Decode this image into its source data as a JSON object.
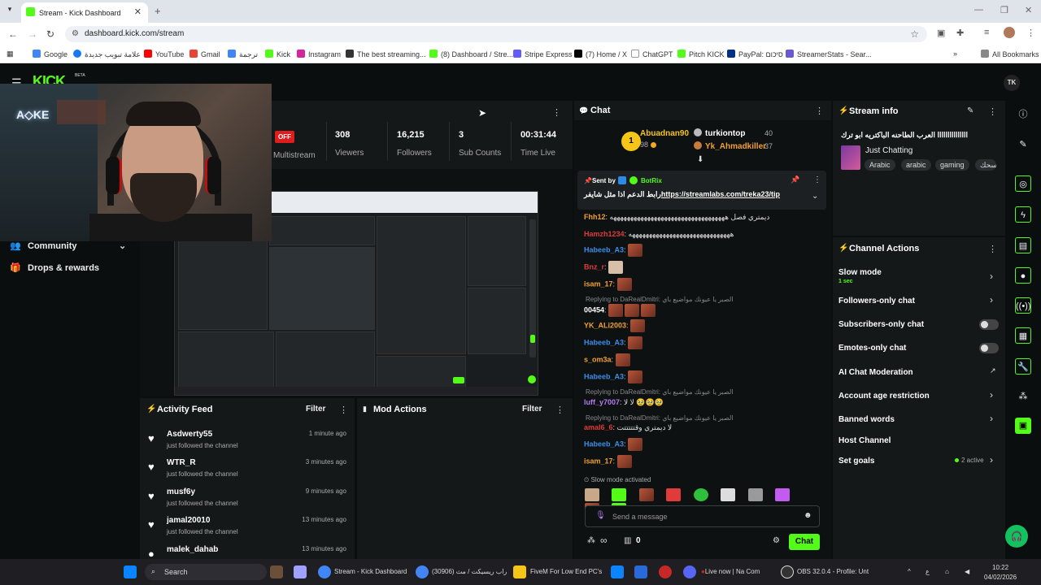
{
  "browser": {
    "tab_title": "Stream - Kick Dashboard",
    "url": "dashboard.kick.com/stream",
    "bookmarks": [
      "Google",
      "علامة تبويب جديدة",
      "YouTube",
      "Gmail",
      "ترجمة",
      "Kick",
      "Instagram",
      "The best streaming...",
      "(8) Dashboard / Stre...",
      "Stripe Express",
      "(7) Home / X",
      "ChatGPT",
      "Pitch KICK",
      "PayPal: סיכום",
      "StreamerStats - Sear..."
    ],
    "all_bookmarks": "All Bookmarks"
  },
  "kick": {
    "logo": "KICK",
    "beta": "BETA",
    "avatar_initials": "TK"
  },
  "sidebar": {
    "items": [
      {
        "label": "Community"
      },
      {
        "label": "Drops & rewards"
      }
    ]
  },
  "stats": {
    "status": "OFF",
    "multistream": "Multistream",
    "items": [
      {
        "value": "308",
        "label": "Viewers"
      },
      {
        "value": "16,215",
        "label": "Followers"
      },
      {
        "value": "3",
        "label": "Sub Counts"
      },
      {
        "value": "00:31:44",
        "label": "Time Live"
      }
    ]
  },
  "activity": {
    "title": "Activity Feed",
    "filter": "Filter",
    "items": [
      {
        "name": "Asdwerty55",
        "desc": "just followed the channel",
        "time": "1 minute ago"
      },
      {
        "name": "WTR_R",
        "desc": "just followed the channel",
        "time": "3 minutes ago"
      },
      {
        "name": "musf6y",
        "desc": "just followed the channel",
        "time": "9 minutes ago"
      },
      {
        "name": "jamal20010",
        "desc": "just followed the channel",
        "time": "13 minutes ago"
      },
      {
        "name": "malek_dahab",
        "desc": "",
        "time": "13 minutes ago"
      }
    ]
  },
  "mod": {
    "title": "Mod Actions",
    "filter": "Filter"
  },
  "chat": {
    "title": "Chat",
    "leaderboard": [
      {
        "rank": "1",
        "name": "Abuadnan90",
        "score": "98"
      },
      {
        "name": "turkiontop",
        "score": "40"
      },
      {
        "name": "Yk_Ahmadkiller",
        "score": "37"
      }
    ],
    "pinned": {
      "sent_by": "Sent by",
      "bot": "BotRix",
      "text": "رابط الدعم اذا مثل شايفر",
      "link": "https://streamlabs.com/treka23/tip"
    },
    "messages": [
      {
        "user": "Fhh12",
        "color": "#f0a030",
        "text": "ديمتري فصل ههههههههههههههههههههههههههههههههههه"
      },
      {
        "user": "Hamzh1234",
        "color": "#e03a3a",
        "text": "ههههههههههههههههههههههههههههههه"
      },
      {
        "user": "Habeeb_A3",
        "color": "#3b8de8",
        "text": ""
      },
      {
        "user": "Bnz_r",
        "color": "#e03a3a",
        "text": ""
      },
      {
        "user": "isam_17",
        "color": "#f0a030",
        "text": ""
      },
      {
        "user": "00454",
        "color": "#ffffff",
        "text": "",
        "reply": "Replying to DaRealDmitri: الصبر يا عيونك مواضيع باي"
      },
      {
        "user": "YK_ALi2003",
        "color": "#f0a030",
        "text": ""
      },
      {
        "user": "Habeeb_A3",
        "color": "#3b8de8",
        "text": ""
      },
      {
        "user": "s_om3a",
        "color": "#f0a030",
        "text": ""
      },
      {
        "user": "Habeeb_A3",
        "color": "#3b8de8",
        "text": ""
      },
      {
        "user": "luff_y7007",
        "color": "#b67cf0",
        "text": "لا لا 🥹🥹🥹",
        "reply": "Replying to DaRealDmitri: الصبر يا عيونك مواضيع باي"
      },
      {
        "user": "amal6_6",
        "color": "#e03a3a",
        "text": "لا ديمتري وقتتتتتت",
        "reply": "Replying to DaRealDmitri: الصبر يا عيونك مواضيع باي"
      },
      {
        "user": "Habeeb_A3",
        "color": "#3b8de8",
        "text": ""
      },
      {
        "user": "isam_17",
        "color": "#f0a030",
        "text": ""
      }
    ],
    "slow_notice": "Slow mode activated",
    "placeholder": "Send a message",
    "infinity": "∞",
    "count": "0",
    "send": "Chat"
  },
  "stream_info": {
    "title": "Stream info",
    "stream_title": "ااااااااااااااا العرب الطاحنه الباكتريه ابو ترك",
    "category": "Just Chatting",
    "tags": [
      "Arabic",
      "arabic",
      "gaming",
      "مسحك"
    ]
  },
  "channel_actions": {
    "title": "Channel Actions",
    "items": [
      {
        "label": "Slow mode",
        "sub": "1 sec"
      },
      {
        "label": "Followers-only chat"
      },
      {
        "label": "Subscribers-only chat"
      },
      {
        "label": "Emotes-only chat"
      },
      {
        "label": "AI Chat Moderation"
      },
      {
        "label": "Account age restriction"
      },
      {
        "label": "Banned words"
      },
      {
        "label": "Host Channel"
      },
      {
        "label": "Set goals",
        "sub": "2 active"
      }
    ]
  },
  "taskbar": {
    "search": "Search",
    "items": [
      "Stream - Kick Dashboard",
      "(30906) راب ريسيكت / مث",
      "FiveM For Low End PC's",
      "Live now | Na Com",
      "OBS 32.0.4 - Profile: Unt"
    ],
    "lang": "ع",
    "time": "10:22",
    "date": "04/02/2026"
  },
  "colors": {
    "accent": "#53fc18",
    "live_red": "#e01d1d"
  }
}
